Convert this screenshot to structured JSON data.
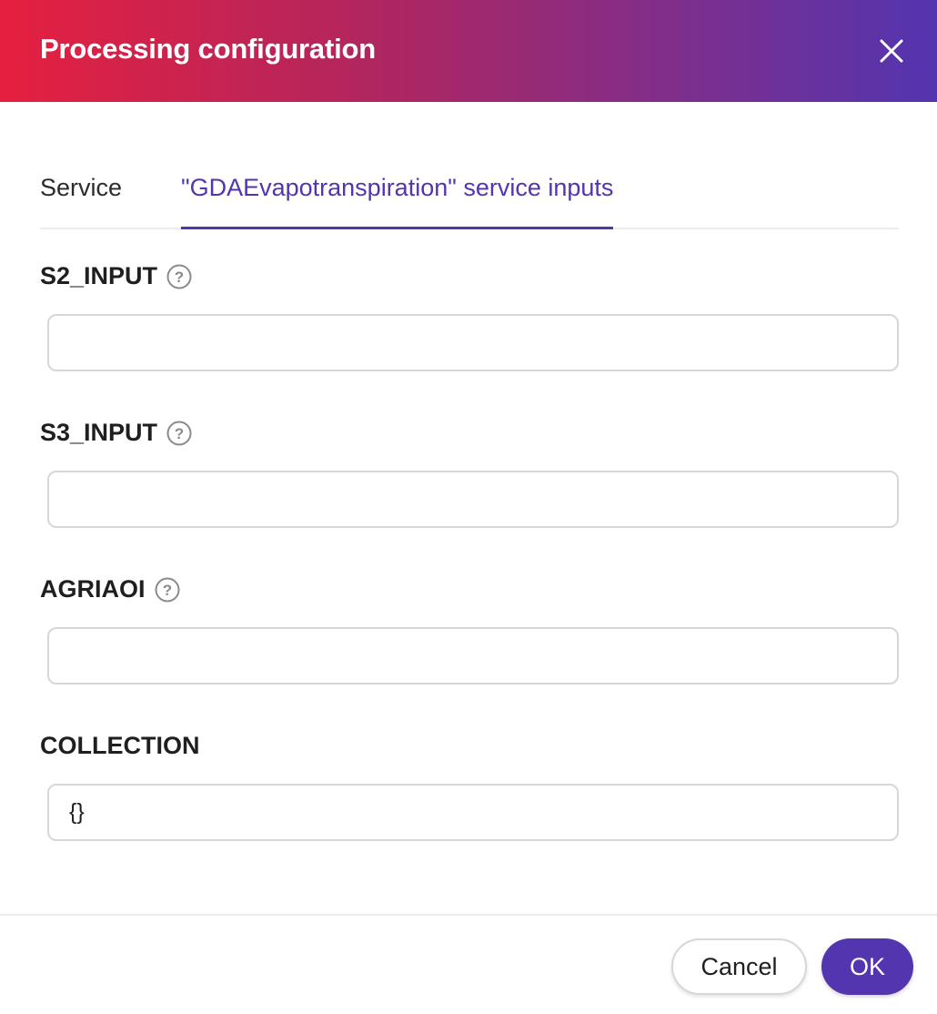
{
  "dialog": {
    "title": "Processing configuration",
    "close_icon": "close-icon",
    "header_gradient": [
      "#e5203f",
      "#5335b0"
    ]
  },
  "tabs": [
    {
      "label": "Service",
      "active": false
    },
    {
      "label": "\"GDAEvapotranspiration\" service inputs",
      "active": true
    }
  ],
  "fields": [
    {
      "label": "S2_INPUT",
      "has_help": true,
      "value": ""
    },
    {
      "label": "S3_INPUT",
      "has_help": true,
      "value": ""
    },
    {
      "label": "AGRIAOI",
      "has_help": true,
      "value": ""
    },
    {
      "label": "COLLECTION",
      "has_help": false,
      "value": "{}"
    }
  ],
  "footer": {
    "cancel_label": "Cancel",
    "ok_label": "OK"
  },
  "colors": {
    "accent": "#5335b0"
  }
}
